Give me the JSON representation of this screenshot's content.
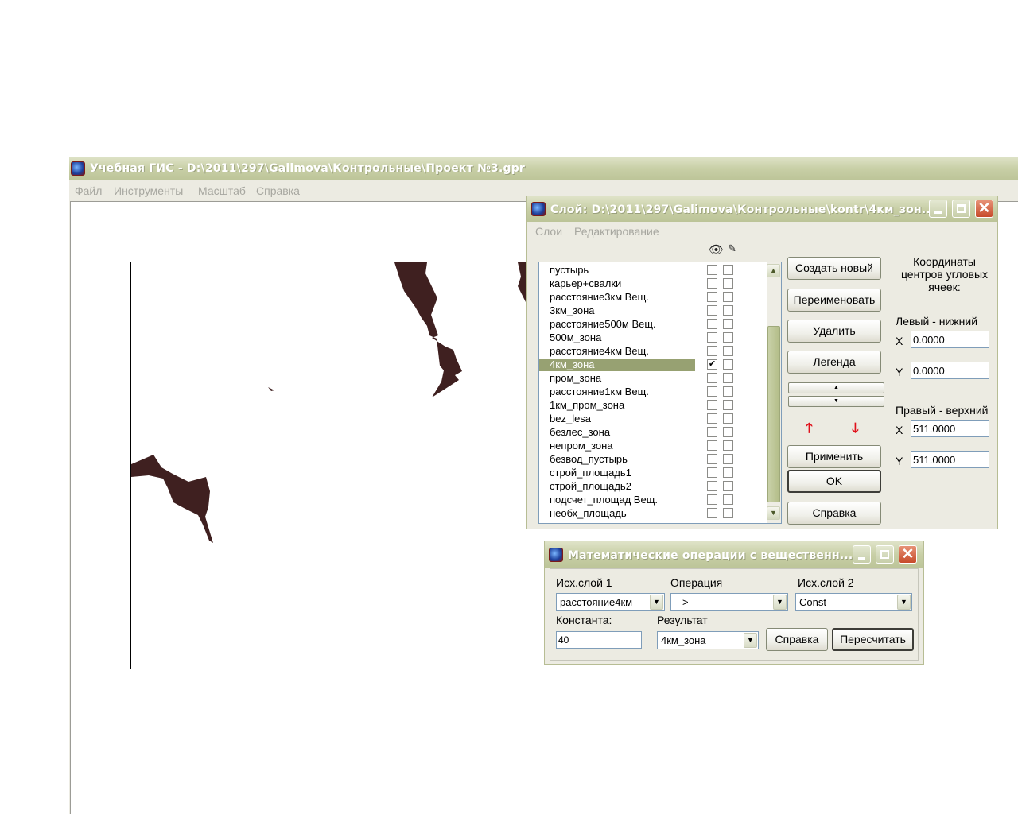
{
  "main_window": {
    "title": "Учебная ГИС - D:\\2011\\297\\Galimova\\Контрольные\\Проект №3.gpr",
    "menu": [
      "Файл",
      "Инструменты",
      "Масштаб",
      "Справка"
    ]
  },
  "layer_dialog": {
    "title": "Слой: D:\\2011\\297\\Galimova\\Контрольные\\kontr\\4км_зон...",
    "menu": [
      "Слои",
      "Редактирование"
    ],
    "column_icons": [
      "eye-icon",
      "pencil-icon"
    ],
    "layers": [
      {
        "name": "пустырь",
        "visible": false,
        "editable": false
      },
      {
        "name": "карьер+свалки",
        "visible": false,
        "editable": false
      },
      {
        "name": "расстояние3км Вещ.",
        "visible": false,
        "editable": false
      },
      {
        "name": "3км_зона",
        "visible": false,
        "editable": false
      },
      {
        "name": "расстояние500м Вещ.",
        "visible": false,
        "editable": false
      },
      {
        "name": "500м_зона",
        "visible": false,
        "editable": false
      },
      {
        "name": "расстояние4км Вещ.",
        "visible": false,
        "editable": false
      },
      {
        "name": "4км_зона",
        "visible": true,
        "editable": false,
        "selected": true
      },
      {
        "name": "пром_зона",
        "visible": false,
        "editable": false
      },
      {
        "name": "расстояние1км Вещ.",
        "visible": false,
        "editable": false
      },
      {
        "name": "1км_пром_зона",
        "visible": false,
        "editable": false
      },
      {
        "name": "bez_lesa",
        "visible": false,
        "editable": false
      },
      {
        "name": "безлес_зона",
        "visible": false,
        "editable": false
      },
      {
        "name": "непром_зона",
        "visible": false,
        "editable": false
      },
      {
        "name": "безвод_пустырь",
        "visible": false,
        "editable": false
      },
      {
        "name": "строй_площадь1",
        "visible": false,
        "editable": false
      },
      {
        "name": "строй_площадь2",
        "visible": false,
        "editable": false
      },
      {
        "name": "подсчет_площад Вещ.",
        "visible": false,
        "editable": false
      },
      {
        "name": "необх_площадь",
        "visible": false,
        "editable": false
      }
    ],
    "buttons": {
      "create": "Создать новый",
      "rename": "Переименовать",
      "delete": "Удалить",
      "legend": "Легенда",
      "apply": "Применить",
      "ok": "OK",
      "help": "Справка"
    },
    "coords": {
      "heading": "Координаты центров угловых ячеек:",
      "lower_left_label": "Левый - нижний",
      "upper_right_label": "Правый - верхний",
      "x_label": "X",
      "y_label": "Y",
      "lower_left_x": "0.0000",
      "lower_left_y": "0.0000",
      "upper_right_x": "511.0000",
      "upper_right_y": "511.0000"
    }
  },
  "math_dialog": {
    "title": "Математические операции с вещественн...",
    "src1_label": "Исх.слой 1",
    "src1_value": "расстояние4км",
    "op_label": "Операция",
    "op_value": ">",
    "src2_label": "Исх.слой 2",
    "src2_value": "Const",
    "const_label": "Константа:",
    "const_value": "40",
    "result_label": "Результат",
    "result_value": "4км_зона",
    "help_button": "Справка",
    "recalc_button": "Пересчитать"
  },
  "colors": {
    "titlebar_inactive": "#c8cfa6",
    "selection": "#97a172",
    "map_fill": "#3f2020"
  }
}
